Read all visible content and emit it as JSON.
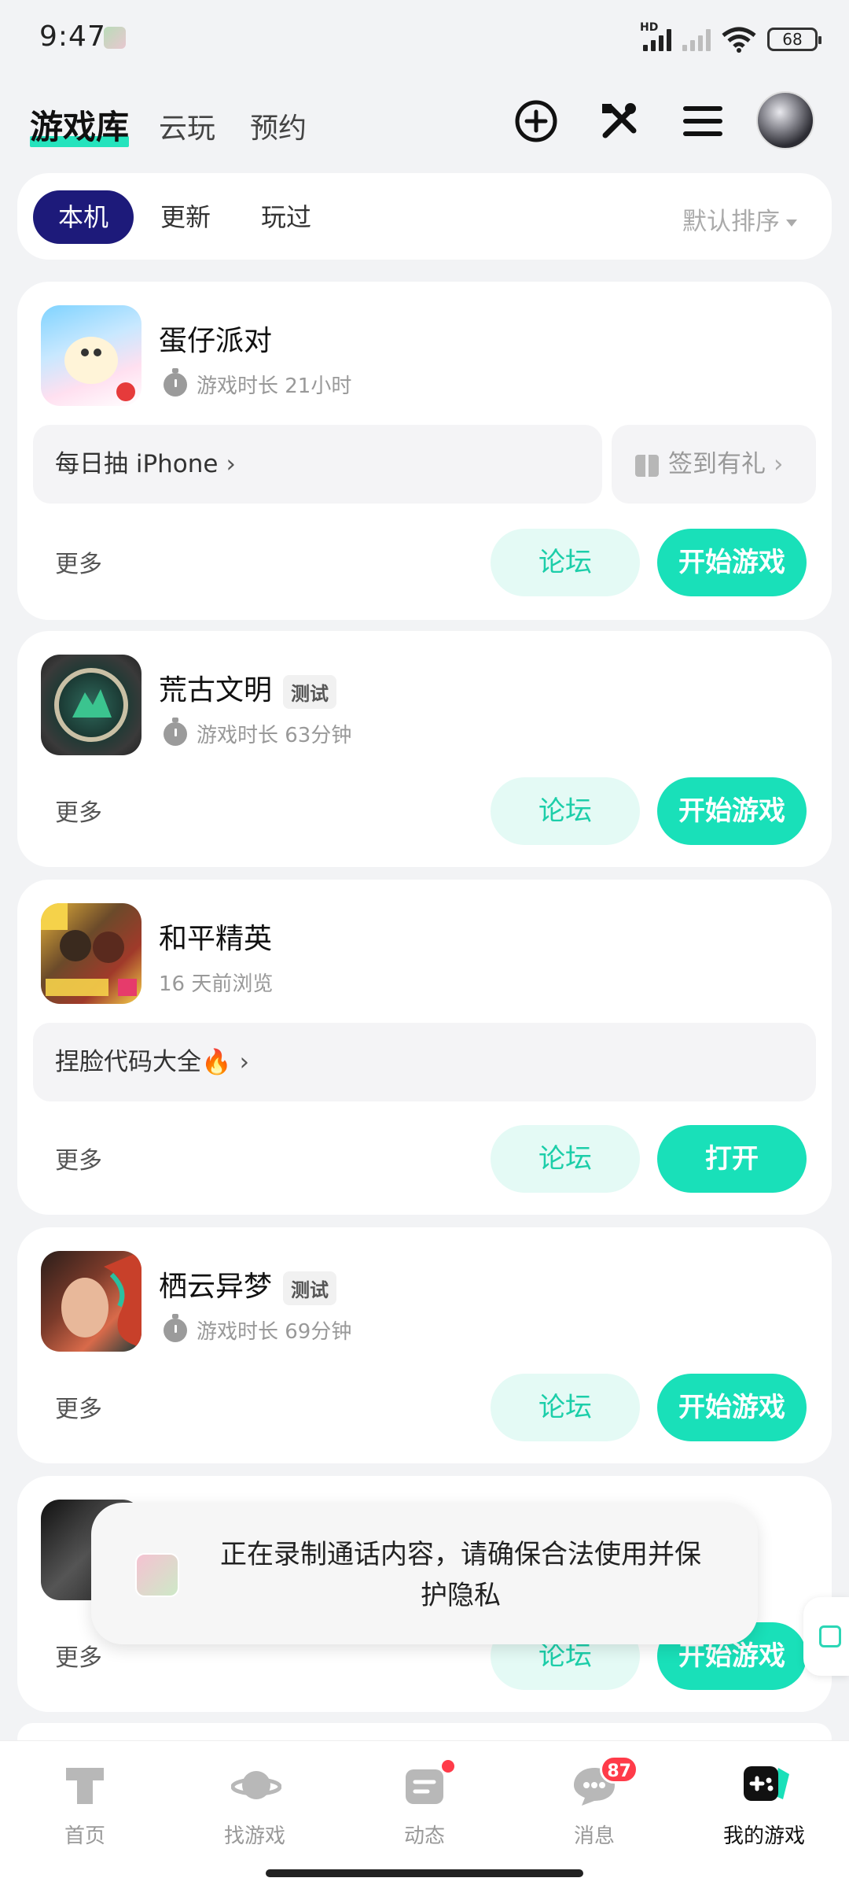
{
  "status_bar": {
    "time": "9:47",
    "battery": "68",
    "network": "HD"
  },
  "header": {
    "tabs": [
      {
        "label": "游戏库",
        "active": true
      },
      {
        "label": "云玩"
      },
      {
        "label": "预约"
      }
    ],
    "icons": [
      "add-circle-icon",
      "tools-icon",
      "menu-icon",
      "avatar"
    ]
  },
  "filter": {
    "chips": [
      {
        "label": "本机",
        "active": true
      },
      {
        "label": "更新"
      },
      {
        "label": "玩过"
      }
    ],
    "sort_label": "默认排序"
  },
  "games": [
    {
      "name": "蛋仔派对",
      "meta": "游戏时长 21小时",
      "promo_main": "每日抽 iPhone",
      "promo_side": "签到有礼",
      "more": "更多",
      "forum": "论坛",
      "action": "开始游戏"
    },
    {
      "name": "荒古文明",
      "tag": "测试",
      "meta": "游戏时长 63分钟",
      "more": "更多",
      "forum": "论坛",
      "action": "开始游戏"
    },
    {
      "name": "和平精英",
      "meta": "16 天前浏览",
      "promo_main": "捏脸代码大全🔥",
      "more": "更多",
      "forum": "论坛",
      "action": "打开"
    },
    {
      "name": "栖云异梦",
      "tag": "测试",
      "meta": "游戏时长 69分钟",
      "more": "更多",
      "forum": "论坛",
      "action": "开始游戏"
    },
    {
      "more": "更多",
      "forum": "论坛",
      "action": "开始游戏"
    }
  ],
  "toast": {
    "text": "正在录制通话内容，请确保合法使用并保护隐私"
  },
  "bottom_nav": [
    {
      "label": "首页"
    },
    {
      "label": "找游戏"
    },
    {
      "label": "动态"
    },
    {
      "label": "消息",
      "badge": "87"
    },
    {
      "label": "我的游戏",
      "active": true
    }
  ],
  "colors": {
    "accent": "#19e0b9",
    "chip_active": "#1d1a7a",
    "badge": "#ff3b49"
  }
}
